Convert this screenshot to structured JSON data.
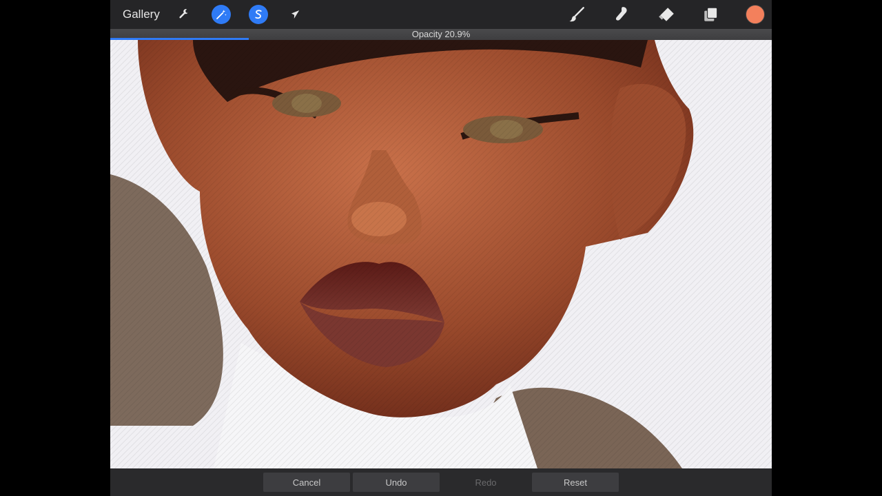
{
  "toolbar": {
    "gallery_label": "Gallery",
    "left_tools": [
      {
        "name": "actions",
        "icon": "wrench-icon",
        "active": false
      },
      {
        "name": "adjustments",
        "icon": "magic-wand-icon",
        "active": true
      },
      {
        "name": "selection",
        "icon": "selection-s-icon",
        "active": true
      },
      {
        "name": "transform",
        "icon": "arrow-cursor-icon",
        "active": false
      }
    ],
    "right_tools": [
      {
        "name": "brush",
        "icon": "brush-icon"
      },
      {
        "name": "smudge",
        "icon": "smudge-icon"
      },
      {
        "name": "eraser",
        "icon": "eraser-icon"
      },
      {
        "name": "layers",
        "icon": "layers-icon"
      }
    ],
    "current_color": "#f3805c"
  },
  "opacity": {
    "label": "Opacity 20.9%",
    "value_percent": 20.9,
    "accent_color": "#2f7bf6"
  },
  "bottom_actions": {
    "cancel": "Cancel",
    "undo": "Undo",
    "redo": "Redo",
    "reset": "Reset"
  }
}
